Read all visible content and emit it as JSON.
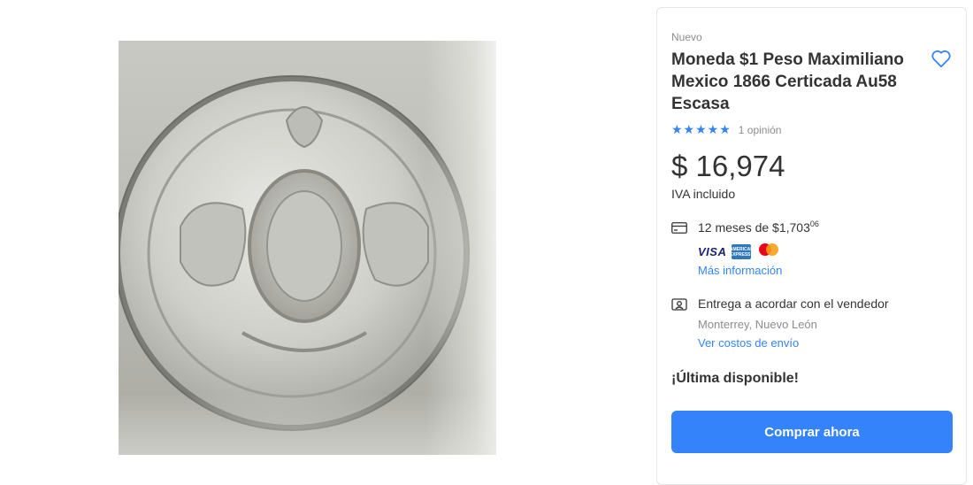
{
  "product_image": {
    "alt": ""
  },
  "panel": {
    "condition": "Nuevo",
    "title": "Moneda $1 Peso Maximiliano Mexico 1866 Certicada Au58 Escasa",
    "rating": {
      "stars": "★★★★★",
      "reviews": "1 opinión"
    },
    "price": "$ 16,974",
    "tax_note": "IVA incluido",
    "installments": {
      "text": "12 meses de $1,703",
      "cents": "06"
    },
    "payment_logos": {
      "visa": "VISA",
      "amex": "AMERICAN EXPRESS"
    },
    "more_info": "Más información",
    "shipping": {
      "text": "Entrega a acordar con el vendedor",
      "location": "Monterrey, Nuevo León",
      "costs_link": "Ver costos de envío"
    },
    "stock": "¡Última disponible!",
    "buy_button": "Comprar ahora"
  },
  "colors": {
    "accent": "#3483fa",
    "text": "#333333",
    "muted": "#8c8c8c",
    "mastercard_red": "#eb001b",
    "mastercard_yellow": "#f79e1b"
  },
  "icons": {
    "favorite": "heart-outline-icon",
    "installments": "credit-card-icon",
    "shipping": "pickup-person-icon"
  }
}
